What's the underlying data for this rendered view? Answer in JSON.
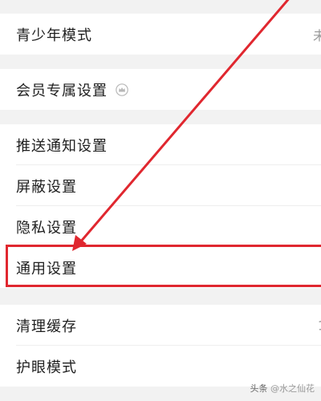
{
  "settings": {
    "group1": {
      "items": [
        {
          "label": "青少年模式",
          "value": "未"
        }
      ]
    },
    "group2": {
      "items": [
        {
          "label": "会员专属设置",
          "icon": "crown-icon"
        }
      ]
    },
    "group3": {
      "items": [
        {
          "label": "推送通知设置"
        },
        {
          "label": "屏蔽设置"
        },
        {
          "label": "隐私设置"
        },
        {
          "label": "通用设置"
        }
      ]
    },
    "group4": {
      "items": [
        {
          "label": "清理缓存",
          "value": "1"
        },
        {
          "label": "护眼模式"
        }
      ]
    }
  },
  "annotation": {
    "highlighted_item": "通用设置",
    "color": "#e0272f"
  },
  "watermark": {
    "prefix": "头条",
    "author": "@水之仙花"
  }
}
